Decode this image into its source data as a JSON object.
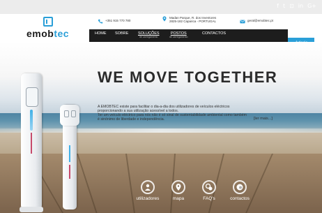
{
  "header": {
    "logo_prefix": "emob",
    "logo_accent": "tec",
    "phone": "+351 915 770 780",
    "address_line1": "Madan Parque, R. dos Inventores",
    "address_line2": "2825-182 Caparica - PORTUGAL",
    "email": "geral@emobtec.pt",
    "aderir_label": "Aderir",
    "social": [
      "f",
      "t",
      "⊡",
      "in",
      "G+"
    ]
  },
  "nav": {
    "items": [
      {
        "label": "HOME",
        "sub": ""
      },
      {
        "label": "SOBRE",
        "sub": ""
      },
      {
        "label": "SOLUÇÕES",
        "sub": "de carregamento"
      },
      {
        "label": "POSTOS",
        "sub": "de carregamento"
      },
      {
        "label": "CONTACTOS",
        "sub": ""
      }
    ]
  },
  "hero": {
    "headline": "WE MOVE TOGETHER",
    "intro_1": "A EMOBTEC existe para facilitar o dia-a-dia dos utilizadores de veículos eléctricos",
    "intro_2": "proporcionando a sua utilização acessível a todos.",
    "intro_3": "Ter um veículo eléctrico para nós não é só sinal de sustentabilidade ambiental como também",
    "intro_4": "é sinónimo de liberdade e independência.",
    "read_more": "[ler mais...]"
  },
  "bottom_nav": [
    {
      "label": "utilizadores",
      "icon": "user-icon"
    },
    {
      "label": "mapa",
      "icon": "map-pin-icon"
    },
    {
      "label": "FAQ's",
      "icon": "faq-icon"
    },
    {
      "label": "contactos",
      "icon": "contact-icon"
    }
  ],
  "colors": {
    "accent": "#2a9fd8",
    "nav_bg": "#1d1d1d"
  }
}
